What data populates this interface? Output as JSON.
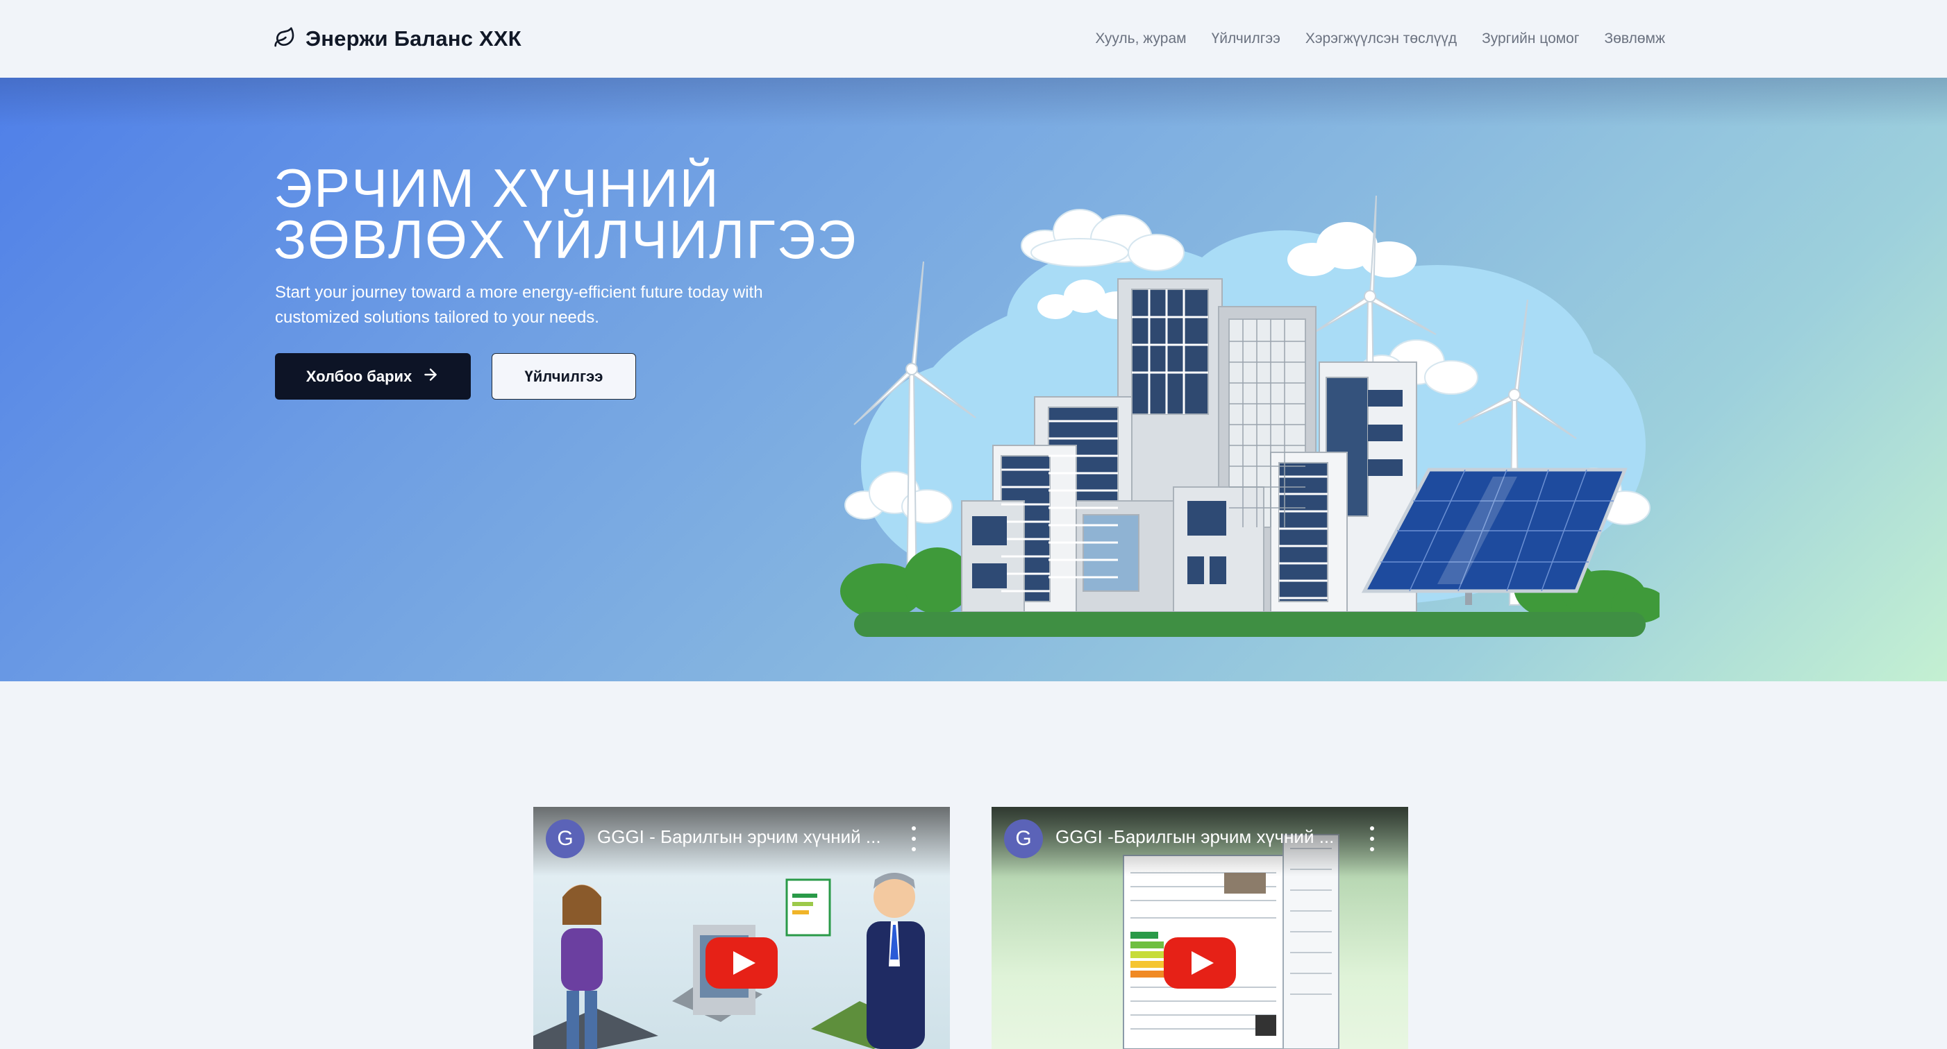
{
  "header": {
    "brand": "Энержи Баланс ХХК",
    "nav": [
      "Хууль, журам",
      "Үйлчилгээ",
      "Хэрэгжүүлсэн төслүүд",
      "Зургийн цомог",
      "Зөвлөмж"
    ]
  },
  "hero": {
    "title_line1": "ЭРЧИМ ХҮЧНИЙ",
    "title_line2": "ЗӨВЛӨХ ҮЙЛЧИЛГЭЭ",
    "subtitle": "Start your journey toward a more energy-efficient future today with customized solutions tailored to your needs.",
    "primary_button": "Холбоо барих",
    "secondary_button": "Үйлчилгээ"
  },
  "videos": [
    {
      "channel_initial": "G",
      "title": "GGGI - Барилгын эрчим хүчний ..."
    },
    {
      "channel_initial": "G",
      "title": "GGGI -Барилгын эрчим хүчний ..."
    }
  ],
  "colors": {
    "primary_button_bg": "#0d1426",
    "youtube_red": "#e62117",
    "channel_avatar": "#5b63b8"
  },
  "icons": {
    "brand": "leaf-icon",
    "primary_button": "arrow-right-icon",
    "video_play": "youtube-play-icon",
    "video_menu": "more-vertical-icon"
  }
}
